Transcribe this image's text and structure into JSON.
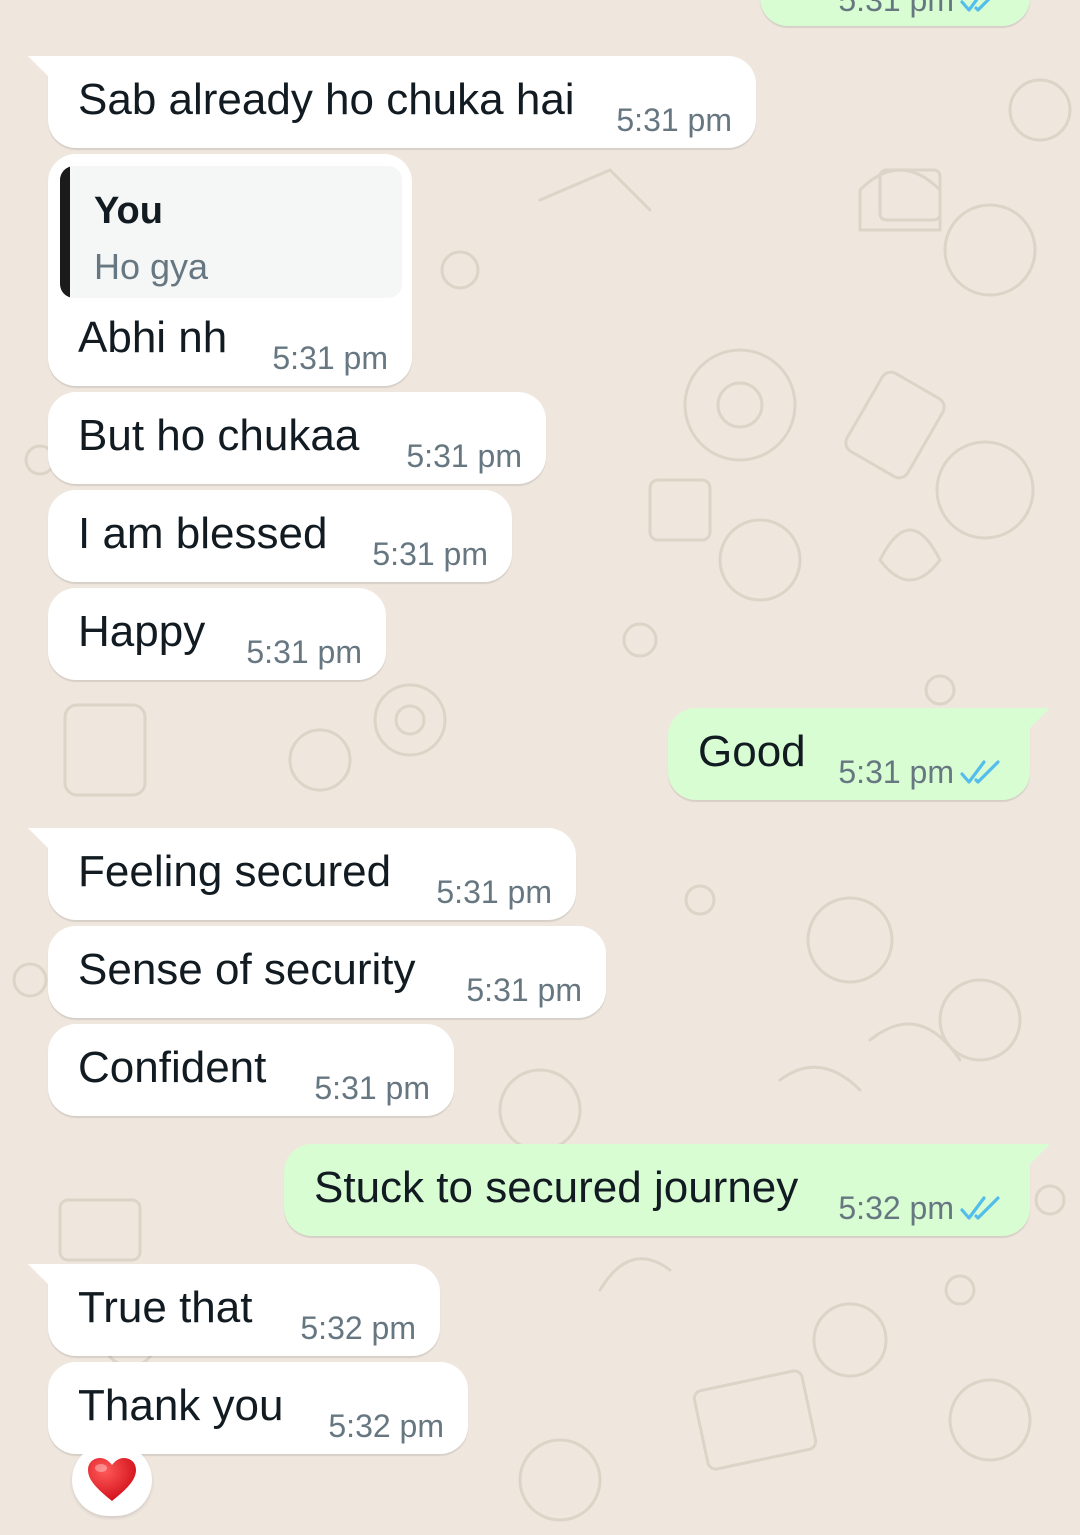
{
  "chat": {
    "colors": {
      "wallpaper": "#efe7de",
      "incoming_bubble": "#ffffff",
      "outgoing_bubble": "#d9fdd3",
      "read_ticks": "#53bdeb"
    },
    "top_partial": {
      "time": "5:31 pm"
    },
    "messages": [
      {
        "text": "Sab already ho chuka hai",
        "time": "5:31 pm"
      },
      {
        "quote_author": "You",
        "quote_text": "Ho gya",
        "text": "Abhi nh",
        "time": "5:31 pm"
      },
      {
        "text": "But ho chukaa",
        "time": "5:31 pm"
      },
      {
        "text": "I am blessed",
        "time": "5:31 pm"
      },
      {
        "text": "Happy",
        "time": "5:31 pm"
      },
      {
        "text": "Good",
        "time": "5:31 pm"
      },
      {
        "text": "Feeling secured",
        "time": "5:31 pm"
      },
      {
        "text": "Sense of security",
        "time": "5:31 pm"
      },
      {
        "text": "Confident",
        "time": "5:31 pm"
      },
      {
        "text": "Stuck to secured journey",
        "time": "5:32 pm"
      },
      {
        "text": "True that",
        "time": "5:32 pm"
      },
      {
        "text": "Thank you",
        "time": "5:32 pm",
        "reaction": "heart-emoji"
      }
    ]
  }
}
